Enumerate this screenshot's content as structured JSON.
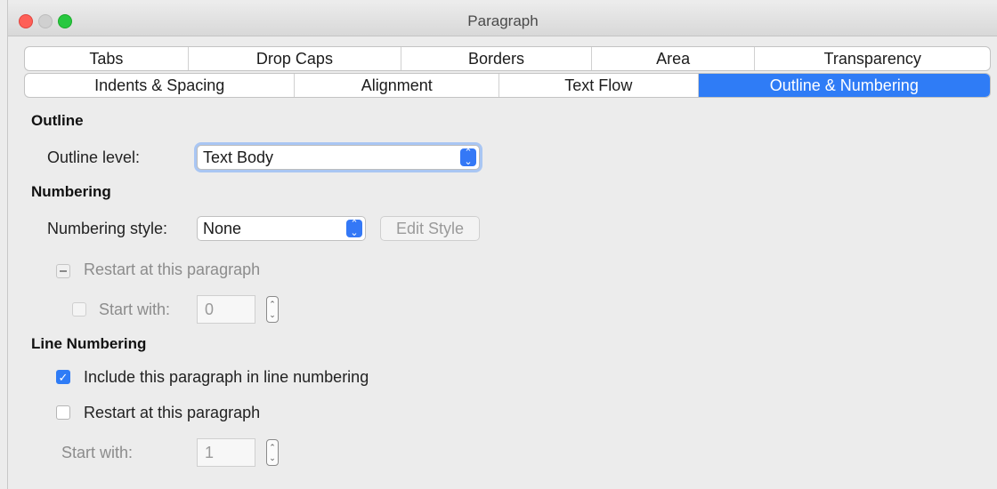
{
  "window": {
    "title": "Paragraph"
  },
  "tabs": {
    "row1": [
      "Tabs",
      "Drop Caps",
      "Borders",
      "Area",
      "Transparency"
    ],
    "row2": [
      "Indents & Spacing",
      "Alignment",
      "Text Flow",
      "Outline & Numbering"
    ],
    "active": "Outline & Numbering"
  },
  "outline": {
    "heading": "Outline",
    "level_label": "Outline level:",
    "level_value": "Text Body"
  },
  "numbering": {
    "heading": "Numbering",
    "style_label": "Numbering style:",
    "style_value": "None",
    "edit_style": "Edit Style",
    "restart_label": "Restart at this paragraph",
    "start_with_label": "Start with:",
    "start_with_value": "0"
  },
  "line_numbering": {
    "heading": "Line Numbering",
    "include_label": "Include this paragraph in line numbering",
    "include_checked": true,
    "restart_label": "Restart at this paragraph",
    "restart_checked": false,
    "start_with_label": "Start with:",
    "start_with_value": "1"
  },
  "colors": {
    "accent": "#2f7cf6",
    "close": "#fe5f57",
    "maximize": "#28c840"
  },
  "icons": {
    "select_arrow": "chevron-up-down-icon",
    "checkmark": "checkmark-icon",
    "spinner": "spinner-arrows-icon"
  }
}
